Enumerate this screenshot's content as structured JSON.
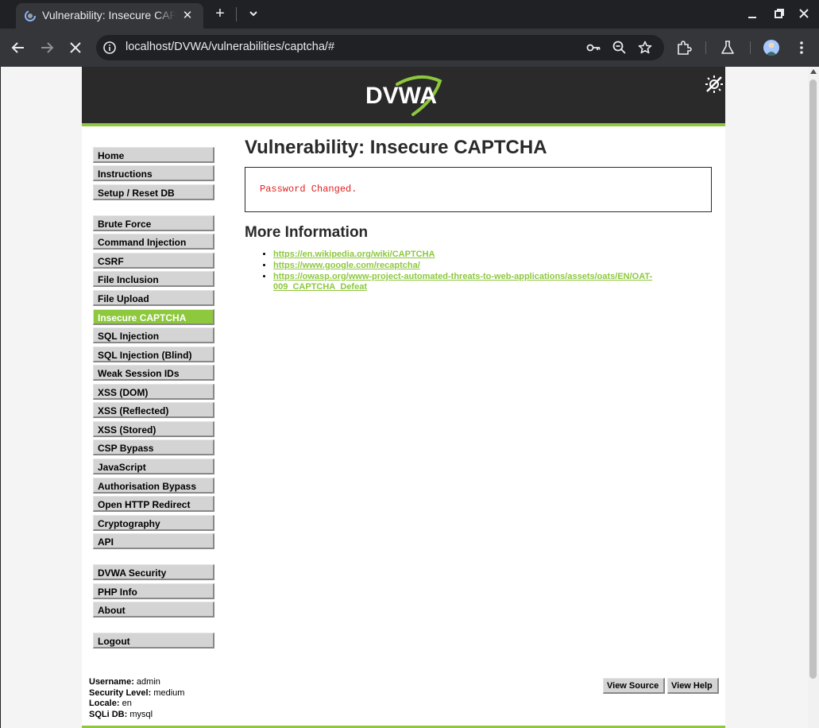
{
  "browser": {
    "tab_title": "Vulnerability: Insecure CAPTCHA :: Damn Vulnerable Web Application (DVWA)",
    "url": "localhost/DVWA/vulnerabilities/captcha/#"
  },
  "header": {
    "logo_text": "DVWA"
  },
  "menu": {
    "group1": [
      {
        "label": "Home"
      },
      {
        "label": "Instructions"
      },
      {
        "label": "Setup / Reset DB"
      }
    ],
    "group2": [
      {
        "label": "Brute Force"
      },
      {
        "label": "Command Injection"
      },
      {
        "label": "CSRF"
      },
      {
        "label": "File Inclusion"
      },
      {
        "label": "File Upload"
      },
      {
        "label": "Insecure CAPTCHA",
        "selected": true
      },
      {
        "label": "SQL Injection"
      },
      {
        "label": "SQL Injection (Blind)"
      },
      {
        "label": "Weak Session IDs"
      },
      {
        "label": "XSS (DOM)"
      },
      {
        "label": "XSS (Reflected)"
      },
      {
        "label": "XSS (Stored)"
      },
      {
        "label": "CSP Bypass"
      },
      {
        "label": "JavaScript"
      },
      {
        "label": "Authorisation Bypass"
      },
      {
        "label": "Open HTTP Redirect"
      },
      {
        "label": "Cryptography"
      },
      {
        "label": "API"
      }
    ],
    "group3": [
      {
        "label": "DVWA Security"
      },
      {
        "label": "PHP Info"
      },
      {
        "label": "About"
      }
    ],
    "group4": [
      {
        "label": "Logout"
      }
    ]
  },
  "main": {
    "title": "Vulnerability: Insecure CAPTCHA",
    "message": "Password Changed.",
    "more_info_heading": "More Information",
    "links": [
      "https://en.wikipedia.org/wiki/CAPTCHA",
      "https://www.google.com/recaptcha/",
      "https://owasp.org/www-project-automated-threats-to-web-applications/assets/oats/EN/OAT-009_CAPTCHA_Defeat"
    ]
  },
  "footer": {
    "username_label": "Username:",
    "username": "admin",
    "security_label": "Security Level:",
    "security": "medium",
    "locale_label": "Locale:",
    "locale": "en",
    "sqli_label": "SQLi DB:",
    "sqli": "mysql",
    "view_source": "View Source",
    "view_help": "View Help"
  },
  "colors": {
    "accent": "#8dc83d",
    "header_bg": "#2a2a2a",
    "message": "#e01f1f"
  }
}
